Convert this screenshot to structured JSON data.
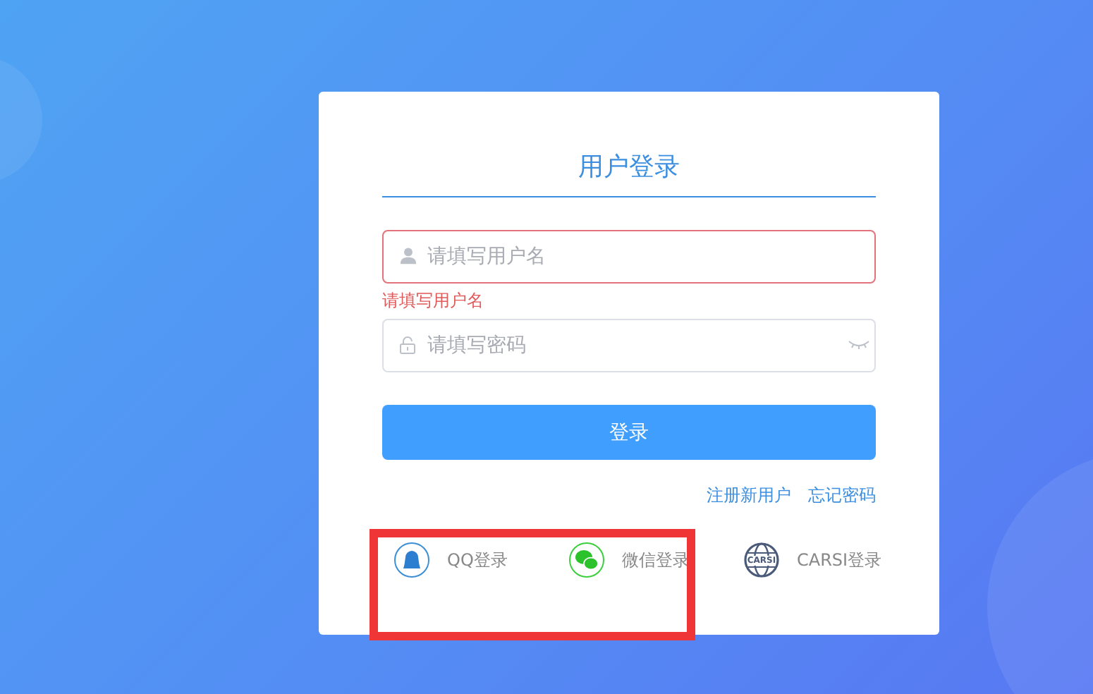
{
  "title": "用户登录",
  "fields": [
    {
      "kind": "user",
      "placeholder": "请填写用户名",
      "error": true,
      "error_text": "请填写用户名"
    },
    {
      "kind": "password",
      "placeholder": "请填写密码",
      "error": false
    }
  ],
  "submit": "登录",
  "links": [
    "注册新用户",
    "忘记密码"
  ],
  "social": [
    {
      "kind": "qq",
      "label": "QQ登录"
    },
    {
      "kind": "wechat",
      "label": "微信登录"
    },
    {
      "kind": "carsi",
      "label": "CARSI登录",
      "logo_text": "CARSI"
    }
  ],
  "highlight": {
    "shown": true
  }
}
